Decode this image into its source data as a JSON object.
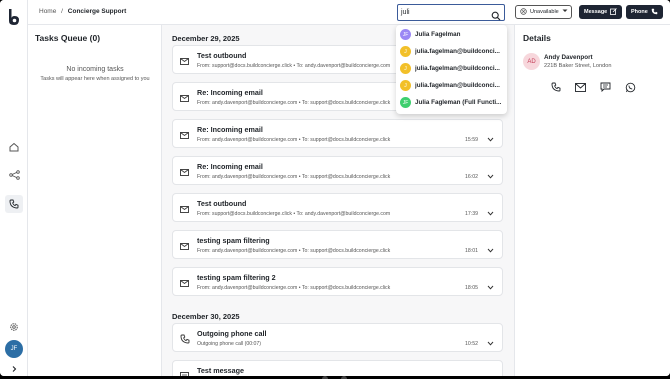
{
  "breadcrumb": {
    "home": "Home",
    "separator": "/",
    "current": "Concierge Support"
  },
  "search": {
    "value": "juli"
  },
  "status_select": {
    "value": "Unavailable"
  },
  "header_buttons": {
    "message": "Message",
    "phone": "Phone"
  },
  "rail": {
    "avatar_initials": "JF"
  },
  "queue": {
    "title": "Tasks Queue (0)",
    "empty_title": "No incoming tasks",
    "empty_sub": "Tasks will appear here when assigned to you"
  },
  "feed": {
    "date1": "December 29, 2025",
    "date2": "December 30, 2025",
    "cards": [
      {
        "title": "Test outbound",
        "meta": "From: support@docs.buildconcierge.click  •  To: andy.davenport@buildconcierge.com",
        "time": ""
      },
      {
        "title": "Re: Incoming email",
        "meta": "From: andy.davenport@buildconcierge.com  •  To: support@docs.buildconcierge.click",
        "time": ""
      },
      {
        "title": "Re: Incoming email",
        "meta": "From: andy.davenport@buildconcierge.com  •  To: support@docs.buildconcierge.click",
        "time": "15:59"
      },
      {
        "title": "Re: Incoming email",
        "meta": "From: andy.davenport@buildconcierge.com  •  To: support@docs.buildconcierge.click",
        "time": "16:02"
      },
      {
        "title": "Test outbound",
        "meta": "From: support@docs.buildconcierge.click  •  To: andy.davenport@buildconcierge.com",
        "time": "17:39"
      },
      {
        "title": "testing spam filtering",
        "meta": "From: andy.davenport@buildconcierge.com  •  To: support@docs.buildconcierge.click",
        "time": "18:01"
      },
      {
        "title": "testing spam filtering 2",
        "meta": "From: andy.davenport@buildconcierge.com  •  To: support@docs.buildconcierge.click",
        "time": "18:05"
      },
      {
        "title": "Outgoing phone call",
        "meta": "Outgoing phone call   (00:07)",
        "time": "10:52"
      },
      {
        "title": "Test message",
        "meta": "",
        "time": ""
      }
    ]
  },
  "details": {
    "title": "Details",
    "avatar_initials": "AD",
    "name": "Andy Davenport",
    "address": "221B Baker Street, London"
  },
  "dropdown": {
    "items": [
      {
        "initial": "JF",
        "label": "Julia Fagelman",
        "color": "#9b87f5"
      },
      {
        "initial": "J",
        "label": "julia.fagelman@buildconci...",
        "color": "#f2c029"
      },
      {
        "initial": "J",
        "label": "julia.fagelman@buildconci...",
        "color": "#f2c029"
      },
      {
        "initial": "J",
        "label": "julia.fagelman@buildconci...",
        "color": "#f2c029"
      },
      {
        "initial": "JF",
        "label": "Julia Fagleman (Full Functi...",
        "color": "#3ecf6e"
      }
    ]
  },
  "colors": {
    "accent": "#1e2533",
    "search_border": "#3b5b9a",
    "avatar_rail": "#2c6ea5"
  }
}
